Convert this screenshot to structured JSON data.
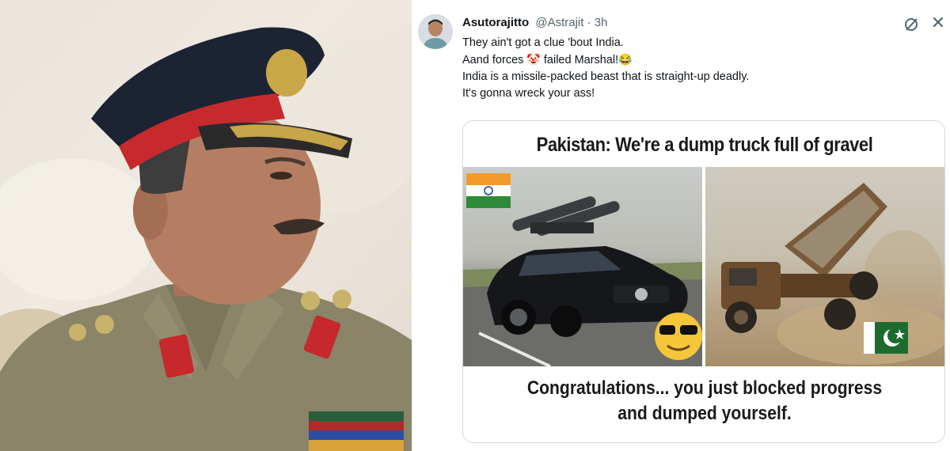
{
  "tweet": {
    "display_name": "Asutorajitto",
    "handle": "@Astrajit · 3h",
    "lines": [
      "They ain't got a clue 'bout India.",
      "Aand forces",
      "failed Marshal!",
      "India is a missile-packed beast that is straight-up deadly.",
      "It's gonna wreck your ass!"
    ],
    "emoji_clown": "🤡",
    "emoji_laugh": "😂"
  },
  "meme": {
    "title": "Pakistan: We're a dump truck full of gravel",
    "caption_line1": "Congratulations... you just blocked progress",
    "caption_line2": "and dumped yourself.",
    "left_panel": "black sedan with missiles on roof, India flag, sunglasses emoji",
    "right_panel": "rusty dump truck dumping gravel, Pakistan flag"
  },
  "icons": {
    "more": "grok-slash-icon",
    "close": "close-icon"
  },
  "colors": {
    "text": "#0f1419",
    "secondary": "#536471",
    "border": "#cfd9de"
  }
}
